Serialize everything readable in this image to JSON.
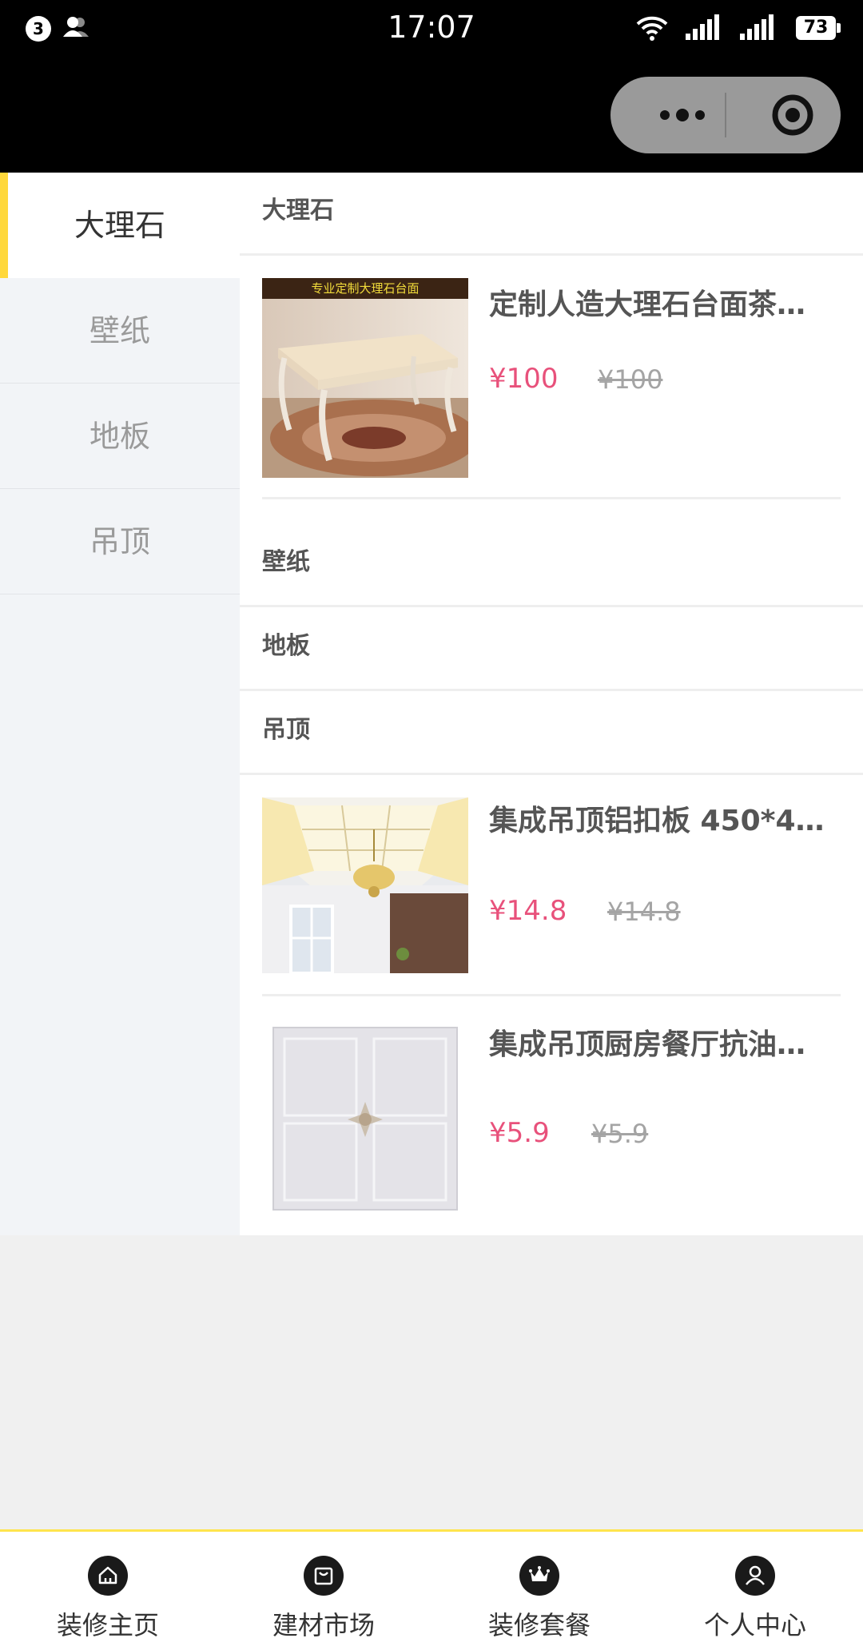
{
  "status_bar": {
    "notification_count": "3",
    "time": "17:07",
    "battery": "73"
  },
  "sidebar": {
    "items": [
      {
        "label": "大理石",
        "active": true
      },
      {
        "label": "壁纸",
        "active": false
      },
      {
        "label": "地板",
        "active": false
      },
      {
        "label": "吊顶",
        "active": false
      }
    ]
  },
  "sections": [
    {
      "title": "大理石",
      "products": [
        {
          "title": "定制人造大理石台面茶…",
          "price": "¥100",
          "original_price": "¥100",
          "image_caption": "专业定制大理石台面",
          "image": "marble-table"
        }
      ]
    },
    {
      "title": "壁纸",
      "products": []
    },
    {
      "title": "地板",
      "products": []
    },
    {
      "title": "吊顶",
      "products": [
        {
          "title": "集成吊顶铝扣板 450*4…",
          "price": "¥14.8",
          "original_price": "¥14.8",
          "image": "ceiling-room"
        },
        {
          "title": "集成吊顶厨房餐厅抗油…",
          "price": "¥5.9",
          "original_price": "¥5.9",
          "image": "ceiling-panel"
        }
      ]
    }
  ],
  "tabbar": {
    "tabs": [
      {
        "label": "装修主页",
        "icon": "home-icon"
      },
      {
        "label": "建材市场",
        "icon": "shopping-bag-icon"
      },
      {
        "label": "装修套餐",
        "icon": "crown-icon"
      },
      {
        "label": "个人中心",
        "icon": "user-icon"
      }
    ]
  },
  "colors": {
    "accent": "#ffd83b",
    "price": "#e8517b",
    "header_bg": "#000000"
  }
}
